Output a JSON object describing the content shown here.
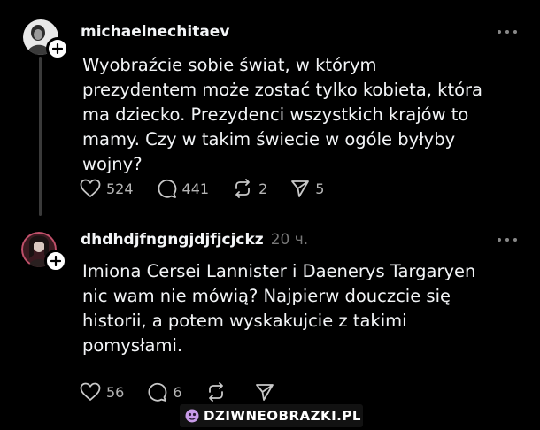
{
  "posts": [
    {
      "username": "michaelnechitaev",
      "time": "",
      "text": "Wyobraźcie sobie świat, w którym\nprezydentem może zostać tylko kobieta, która\nma dziecko. Prezydenci wszystkich krajów to\nmamy. Czy w takim świecie w ogóle byłyby\nwojny?",
      "likes": "524",
      "replies": "441",
      "reposts": "2",
      "shares": "5"
    },
    {
      "username": "dhdhdjfngngjdjfjcjckz",
      "time": "20 ч.",
      "text": "Imiona Cersei Lannister i Daenerys Targaryen\nnic wam nie mówią? Najpierw douczcie się\nhistorii, a potem wyskakujcie z takimi\npomysłami.",
      "likes": "56",
      "replies": "6",
      "reposts": "",
      "shares": ""
    }
  ],
  "watermark": "DZIWNEOBRAZKI.PL",
  "icons": {
    "like": "heart-icon",
    "reply": "comment-icon",
    "repost": "repost-icon",
    "share": "send-icon",
    "more": "more-dots-icon",
    "follow": "plus-icon"
  },
  "colors": {
    "background": "#000000",
    "text": "#f3f5f7",
    "secondary": "#777777",
    "watermark_accent": "#c89be8"
  }
}
